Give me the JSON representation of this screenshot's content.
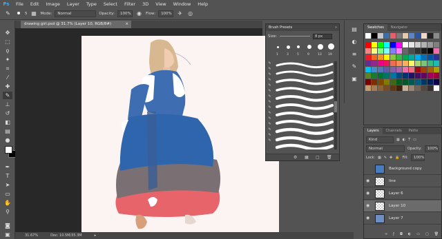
{
  "app": {
    "logo": "Ps"
  },
  "menu": [
    "File",
    "Edit",
    "Image",
    "Layer",
    "Type",
    "Select",
    "Filter",
    "3D",
    "View",
    "Window",
    "Help"
  ],
  "options": {
    "brush_size": "5",
    "mode_label": "Mode:",
    "mode_value": "Normal",
    "opacity_label": "Opacity:",
    "opacity_value": "100%",
    "flow_label": "Flow:",
    "flow_value": "100%"
  },
  "document": {
    "tab_title": "drawing girl.psd @ 31.7% (Layer 10, RGB/8#)",
    "tab_close": "×"
  },
  "status": {
    "zoom": "31.67%",
    "doc": "Doc: 10.5M/35.3M"
  },
  "brush_presets": {
    "title": "Brush Presets",
    "close": "»",
    "size_label": "Size:",
    "size_value": "8 px",
    "preset_sizes": [
      "1",
      "3",
      "5",
      "9",
      "13",
      "19"
    ],
    "preset_sizes_row2": [
      "5",
      "9",
      "13",
      "17",
      "45",
      "65"
    ]
  },
  "dock": {
    "swatches_tab": "Swatches",
    "navigator_tab": "Navigator",
    "layers_tab": "Layers",
    "channels_tab": "Channels",
    "paths_tab": "Paths"
  },
  "layers": {
    "kind_label": "Kind",
    "blend_mode": "Normal",
    "opacity_label": "Opacity:",
    "opacity_value": "100%",
    "lock_label": "Lock:",
    "fill_label": "Fill:",
    "fill_value": "100%",
    "items": [
      {
        "name": "Background copy"
      },
      {
        "name": "line"
      },
      {
        "name": "Layer 6"
      },
      {
        "name": "Layer 10"
      },
      {
        "name": "Layer 7"
      }
    ]
  },
  "swatch_recent": [
    "#ffffff",
    "#000000",
    "#c7c7c7",
    "#3a6fa8",
    "#e85e6a",
    "#7a7a7a",
    "#e6c9a8",
    "#5b86c5",
    "#2a55a0",
    "#f3d8c6",
    "#222222",
    "#8a8a8a"
  ],
  "swatch_colors": [
    "#ff0000",
    "#ffff00",
    "#00ff00",
    "#00ffff",
    "#0000ff",
    "#ff00ff",
    "#ffffff",
    "#e6e6e6",
    "#cccccc",
    "#b3b3b3",
    "#999999",
    "#808080",
    "#ff8080",
    "#ffff80",
    "#80ff80",
    "#80ffff",
    "#8080ff",
    "#ff80ff",
    "#666666",
    "#4d4d4d",
    "#333333",
    "#1a1a1a",
    "#000000",
    "#f06eaa",
    "#ed1c24",
    "#f26522",
    "#f7941d",
    "#fff200",
    "#8dc63f",
    "#39b54a",
    "#00a651",
    "#00a99d",
    "#00aeef",
    "#0072bc",
    "#0054a6",
    "#2e3192",
    "#662d91",
    "#92278f",
    "#ec008c",
    "#ed145b",
    "#f26c4f",
    "#f68e56",
    "#fbaf5d",
    "#fff568",
    "#acd373",
    "#7cc576",
    "#3cb878",
    "#1cbbb4",
    "#00bff3",
    "#448ccb",
    "#5674b9",
    "#605ca8",
    "#8560a8",
    "#a864a8",
    "#f06eaa",
    "#f26d7d",
    "#9e0b0f",
    "#a0410d",
    "#a36209",
    "#aba000",
    "#598527",
    "#197b30",
    "#007236",
    "#00746b",
    "#0076a3",
    "#004a80",
    "#003471",
    "#1b1464",
    "#440e62",
    "#630460",
    "#9e005d",
    "#9e0039",
    "#790000",
    "#7b2e00",
    "#7d4900",
    "#827b00",
    "#406618",
    "#005e20",
    "#005826",
    "#005952",
    "#005b7f",
    "#003663",
    "#002157",
    "#0d004c",
    "#c69c6d",
    "#a67c52",
    "#8c6239",
    "#754c24",
    "#603913",
    "#42210b",
    "#c7b299",
    "#998675",
    "#736357",
    "#534741",
    "#362f2d",
    "#fbfbfb"
  ]
}
